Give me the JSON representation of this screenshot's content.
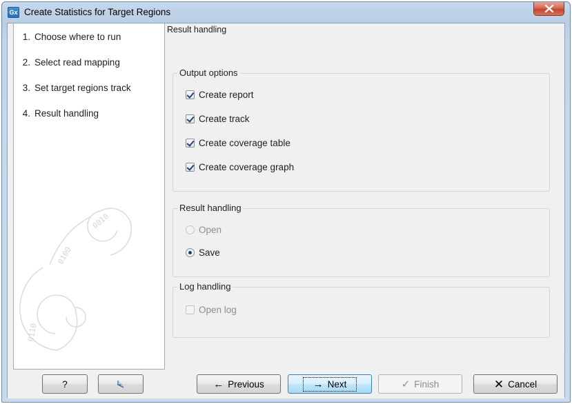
{
  "window": {
    "app_icon_text": "Gx",
    "title": "Create Statistics for Target Regions"
  },
  "steps": [
    {
      "num": "1.",
      "label": "Choose where to run"
    },
    {
      "num": "2.",
      "label": "Select read mapping"
    },
    {
      "num": "3.",
      "label": "Set target regions track"
    },
    {
      "num": "4.",
      "label": "Result handling"
    }
  ],
  "content": {
    "heading": "Result handling",
    "output_options": {
      "title": "Output options",
      "items": [
        {
          "label": "Create report",
          "checked": true
        },
        {
          "label": "Create track",
          "checked": true
        },
        {
          "label": "Create coverage table",
          "checked": true
        },
        {
          "label": "Create coverage graph",
          "checked": true
        }
      ]
    },
    "result_handling": {
      "title": "Result handling",
      "open_label": "Open",
      "open_enabled": false,
      "save_label": "Save",
      "selected": "Save"
    },
    "log_handling": {
      "title": "Log handling",
      "open_log_label": "Open log",
      "open_log_checked": false,
      "open_log_enabled": false
    }
  },
  "buttons": {
    "help": "?",
    "previous": "Previous",
    "next": "Next",
    "finish": "Finish",
    "cancel": "Cancel",
    "finish_enabled": false
  },
  "icons": {
    "close": "close-icon",
    "reset": "reset-arrow-icon",
    "previous": "arrow-left-icon",
    "next": "arrow-right-icon",
    "finish": "checkmark-icon",
    "cancel": "x-icon"
  }
}
